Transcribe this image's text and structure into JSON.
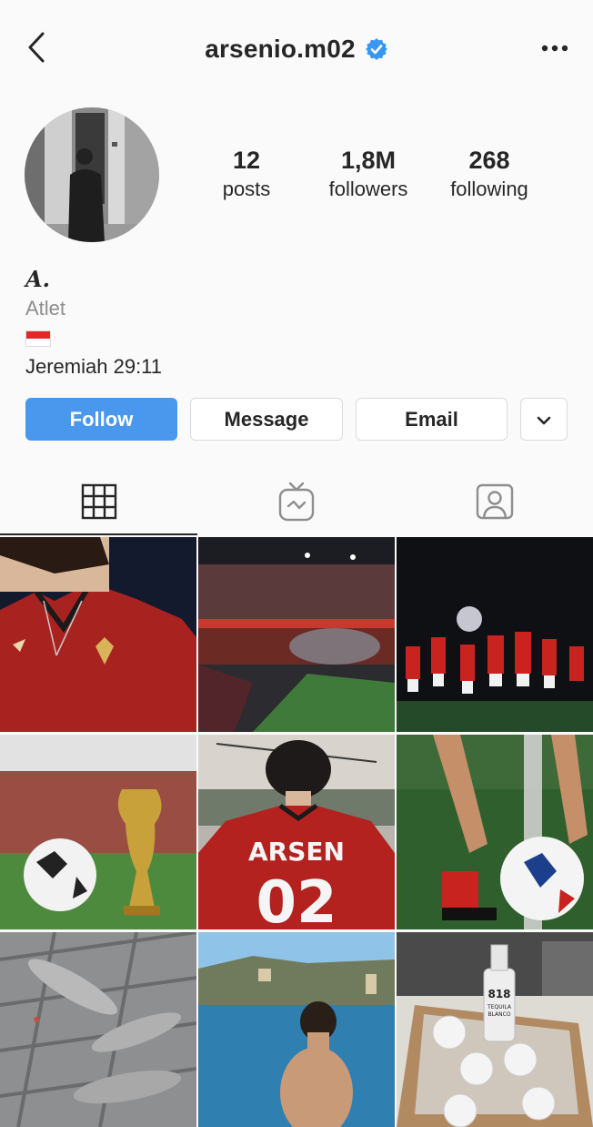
{
  "header": {
    "username": "arsenio.m02",
    "back_icon": "chevron-left-icon",
    "verified_icon": "verified-badge-icon",
    "more_icon": "more-horizontal-icon"
  },
  "stats": {
    "posts": {
      "value": "12",
      "label": "posts"
    },
    "followers": {
      "value": "1,8M",
      "label": "followers"
    },
    "following": {
      "value": "268",
      "label": "following"
    }
  },
  "bio": {
    "name": "𝑨.",
    "category": "Atlet",
    "flag": "Indonesia flag",
    "text": "Jeremiah 29:11"
  },
  "actions": {
    "follow": "Follow",
    "message": "Message",
    "email": "Email",
    "more_icon": "chevron-down-icon"
  },
  "tabs": [
    {
      "icon": "grid-icon",
      "active": true
    },
    {
      "icon": "igtv-icon",
      "active": false
    },
    {
      "icon": "tagged-icon",
      "active": false
    }
  ],
  "posts": [
    {
      "jersey_text": ""
    },
    {
      "jersey_text": ""
    },
    {
      "jersey_text": ""
    },
    {
      "jersey_text": ""
    },
    {
      "jersey_text": "ARSEN",
      "jersey_number": "02"
    },
    {
      "jersey_text": ""
    },
    {
      "jersey_text": ""
    },
    {
      "jersey_text": ""
    },
    {
      "bottle_text_1": "818",
      "bottle_text_2": "TEQUILA",
      "bottle_text_3": "BLANCO"
    }
  ],
  "colors": {
    "accent": "#4a98ed",
    "verified": "#3897f0",
    "jersey_red": "#b3221f"
  }
}
